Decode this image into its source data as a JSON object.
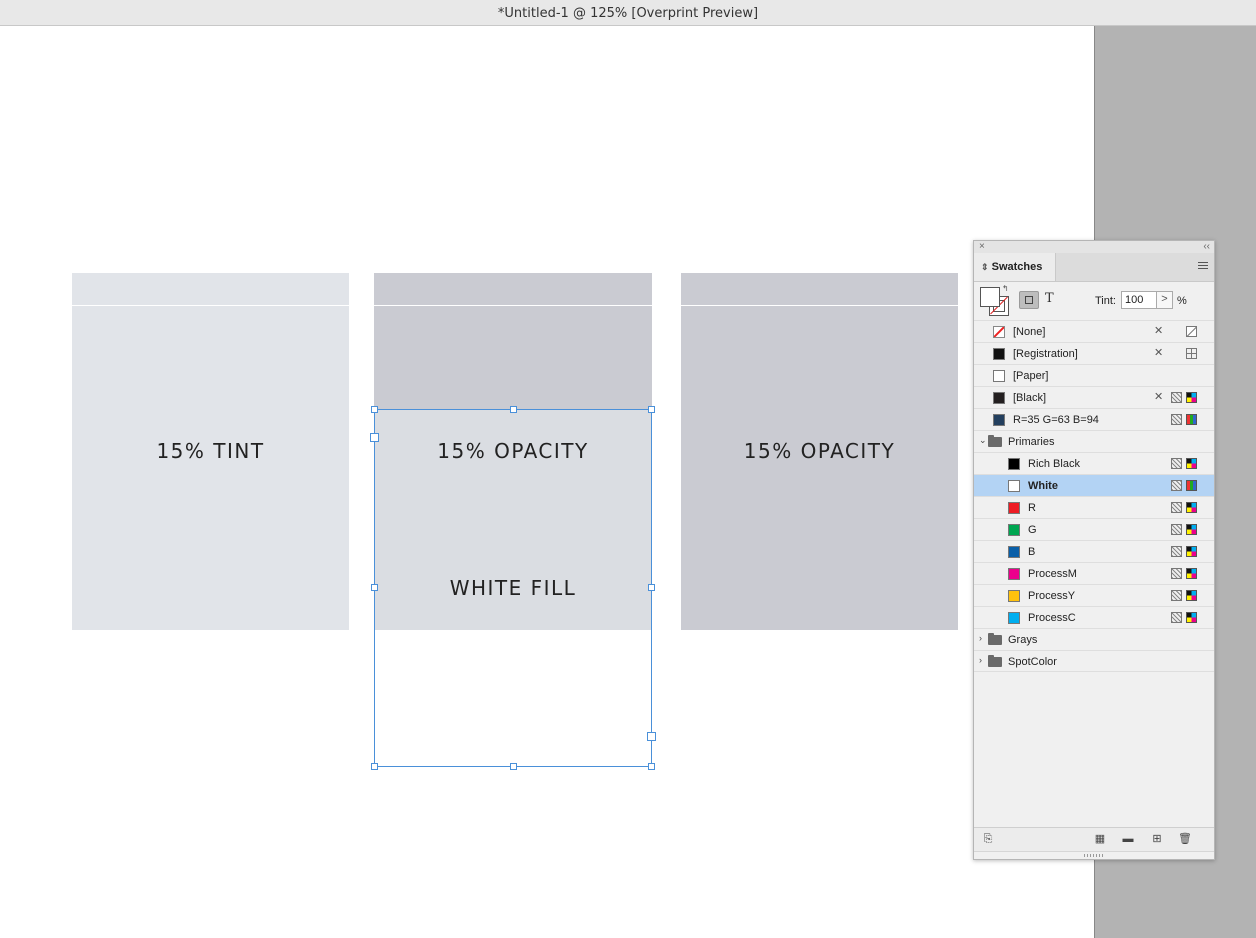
{
  "window": {
    "title": "*Untitled-1 @ 125% [Overprint Preview]"
  },
  "canvas": {
    "boxes": [
      {
        "label": "15% TINT"
      },
      {
        "label": "15% OPACITY",
        "sublabel": "WHITE FILL"
      },
      {
        "label": "15% OPACITY"
      }
    ]
  },
  "swatches_panel": {
    "tab_label": "Swatches",
    "close_glyph": "×",
    "collapse_glyph": "‹‹",
    "tint_label": "Tint:",
    "tint_value": "100",
    "tint_arrow": ">",
    "tint_unit": "%",
    "format_text_glyph": "T",
    "items": [
      {
        "name": "[None]",
        "color": "none",
        "icons": [
          "pencil",
          "none"
        ]
      },
      {
        "name": "[Registration]",
        "color": "#111111",
        "icons": [
          "pencil",
          "registration"
        ]
      },
      {
        "name": "[Paper]",
        "color": "#ffffff",
        "icons": []
      },
      {
        "name": "[Black]",
        "color": "#231f20",
        "icons": [
          "pencil",
          "process",
          "cmyk"
        ]
      },
      {
        "name": "R=35 G=63 B=94",
        "color": "#233f5e",
        "icons": [
          "process",
          "rgb"
        ]
      }
    ],
    "groups": [
      {
        "name": "Primaries",
        "expanded": true,
        "items": [
          {
            "name": "Rich Black",
            "color": "#000000",
            "icons": [
              "process",
              "cmyk"
            ]
          },
          {
            "name": "White",
            "color": "#ffffff",
            "icons": [
              "process",
              "rgb"
            ],
            "selected": true
          },
          {
            "name": "R",
            "color": "#ed1c24",
            "icons": [
              "process",
              "cmyk"
            ]
          },
          {
            "name": "G",
            "color": "#00a651",
            "icons": [
              "process",
              "cmyk"
            ]
          },
          {
            "name": "B",
            "color": "#0a5fa8",
            "icons": [
              "process",
              "cmyk"
            ]
          },
          {
            "name": "ProcessM",
            "color": "#ec008c",
            "icons": [
              "process",
              "cmyk"
            ]
          },
          {
            "name": "ProcessY",
            "color": "#ffc20e",
            "icons": [
              "process",
              "cmyk"
            ]
          },
          {
            "name": "ProcessC",
            "color": "#00aeef",
            "icons": [
              "process",
              "cmyk"
            ]
          }
        ]
      },
      {
        "name": "Grays",
        "expanded": false,
        "items": []
      },
      {
        "name": "SpotColor",
        "expanded": false,
        "items": []
      }
    ]
  },
  "colors": {
    "tint_box": "#e1e4e9",
    "opacity_box": "#cacbd2",
    "white_fill": "#dadde2",
    "selection": "#4a90d9",
    "panel_selected_row": "#b3d3f4"
  }
}
